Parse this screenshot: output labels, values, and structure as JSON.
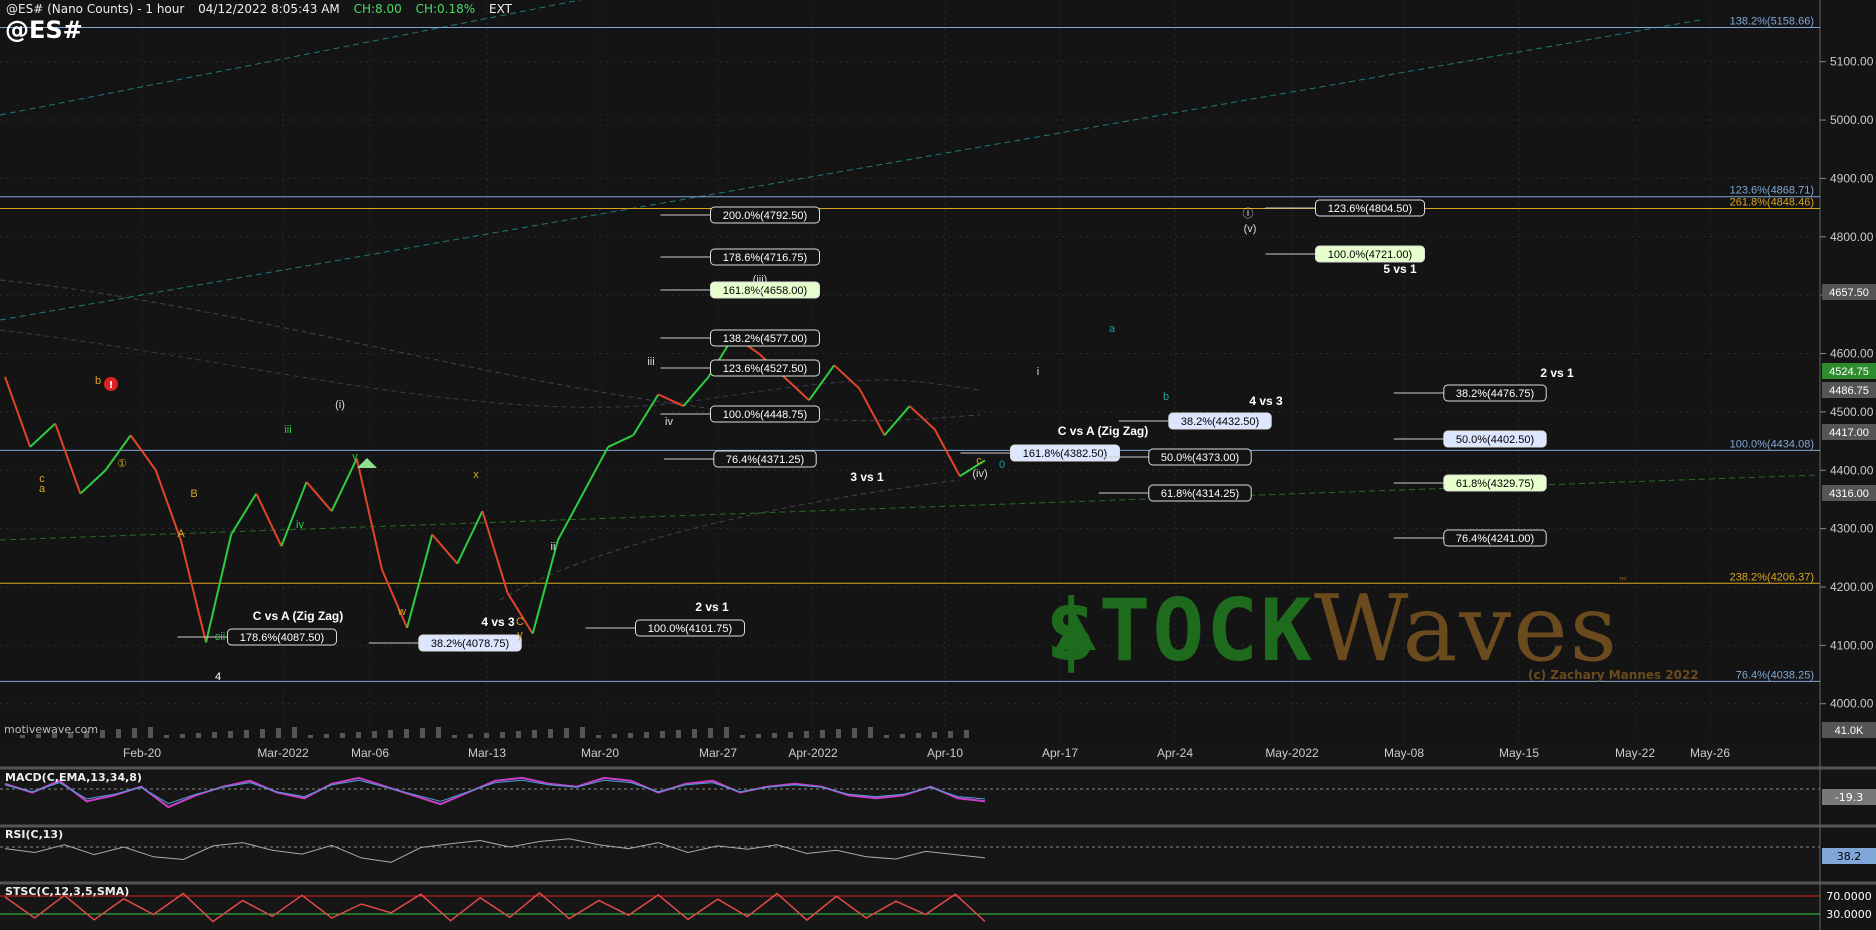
{
  "header": {
    "symbol_desc": "@ES# (Nano Counts) - 1 hour",
    "datetime": "04/12/2022 8:05:43 AM",
    "change": "CH:8.00",
    "change_pct": "CH:0.18%",
    "session": "EXT",
    "symbol": "@ES#",
    "source": "motivewave.com"
  },
  "watermark": {
    "brand1": "$TOCK",
    "brand2": "Waves",
    "tm": "™",
    "copyright": "(c) Zachary Mannes 2022"
  },
  "colors": {
    "bg": "#141414",
    "up": "#2ecc40",
    "down": "#e0452a",
    "grid": "#2a2a2a",
    "fib_gold": "#d9a520",
    "fib_blue": "#7fa8d8"
  },
  "chart_data": [
    {
      "type": "line",
      "title": "@ES# (Nano Counts) - 1 hour",
      "y_axis_ticks": [
        "5100.00",
        "5000.00",
        "4900.00",
        "4800.00",
        "4700.00",
        "4600.00",
        "4500.00",
        "4400.00",
        "4300.00",
        "4200.00",
        "4100.00",
        "4000.00"
      ],
      "x_axis_ticks": [
        "Feb-20",
        "Mar-2022",
        "Mar-06",
        "Mar-13",
        "Mar-20",
        "Mar-27",
        "Apr-2022",
        "Apr-10",
        "Apr-17",
        "Apr-24",
        "May-2022",
        "May-08",
        "May-15",
        "May-22",
        "May-26"
      ],
      "ylim": [
        3955,
        5180
      ],
      "price_path": [
        {
          "x": "Feb-14",
          "y": 4560
        },
        {
          "x": "Feb-15",
          "y": 4440
        },
        {
          "x": "Feb-16",
          "y": 4480
        },
        {
          "x": "Feb-17",
          "y": 4360
        },
        {
          "x": "Feb-18",
          "y": 4400
        },
        {
          "x": "Feb-19",
          "y": 4460
        },
        {
          "x": "Feb-20",
          "y": 4400
        },
        {
          "x": "Feb-22",
          "y": 4280
        },
        {
          "x": "Feb-24",
          "y": 4105
        },
        {
          "x": "Feb-25",
          "y": 4290
        },
        {
          "x": "Feb-28",
          "y": 4360
        },
        {
          "x": "Mar-01",
          "y": 4270
        },
        {
          "x": "Mar-02",
          "y": 4380
        },
        {
          "x": "Mar-04",
          "y": 4330
        },
        {
          "x": "Mar-05",
          "y": 4420
        },
        {
          "x": "Mar-06",
          "y": 4230
        },
        {
          "x": "Mar-08",
          "y": 4130
        },
        {
          "x": "Mar-09",
          "y": 4290
        },
        {
          "x": "Mar-10",
          "y": 4240
        },
        {
          "x": "Mar-11",
          "y": 4330
        },
        {
          "x": "Mar-12",
          "y": 4190
        },
        {
          "x": "Mar-14",
          "y": 4120
        },
        {
          "x": "Mar-15",
          "y": 4280
        },
        {
          "x": "Mar-16",
          "y": 4360
        },
        {
          "x": "Mar-18",
          "y": 4440
        },
        {
          "x": "Mar-20",
          "y": 4460
        },
        {
          "x": "Mar-22",
          "y": 4530
        },
        {
          "x": "Mar-24",
          "y": 4510
        },
        {
          "x": "Mar-27",
          "y": 4560
        },
        {
          "x": "Mar-29",
          "y": 4630
        },
        {
          "x": "Mar-31",
          "y": 4600
        },
        {
          "x": "Apr-01",
          "y": 4560
        },
        {
          "x": "Apr-02",
          "y": 4520
        },
        {
          "x": "Apr-04",
          "y": 4580
        },
        {
          "x": "Apr-05",
          "y": 4540
        },
        {
          "x": "Apr-06",
          "y": 4460
        },
        {
          "x": "Apr-08",
          "y": 4510
        },
        {
          "x": "Apr-10",
          "y": 4470
        },
        {
          "x": "Apr-11",
          "y": 4390
        },
        {
          "x": "Apr-12",
          "y": 4417
        }
      ],
      "price_badges": [
        {
          "label": "4657.50",
          "color": "#555555"
        },
        {
          "label": "4524.75",
          "color": "#2e8b2e"
        },
        {
          "label": "4486.75",
          "color": "#555555"
        },
        {
          "label": "4417.00",
          "color": "#555555"
        },
        {
          "label": "4316.00",
          "color": "#555555"
        },
        {
          "label": "41.0K",
          "color": "#555555"
        }
      ],
      "fib_lines": [
        {
          "label": "138.2%(5158.66)",
          "value": 5158.66,
          "color": "#7fa8d8"
        },
        {
          "label": "123.6%(4868.71)",
          "value": 4868.71,
          "color": "#7fa8d8"
        },
        {
          "label": "261.8%(4848.46)",
          "value": 4848.46,
          "color": "#d9a520"
        },
        {
          "label": "100.0%(4434.08)",
          "value": 4434.08,
          "color": "#7fa8d8"
        },
        {
          "label": "238.2%(4206.37)",
          "value": 4206.37,
          "color": "#d9a520"
        },
        {
          "label": "76.4%(4038.25)",
          "value": 4038.25,
          "color": "#7fa8d8"
        }
      ],
      "fib_boxes": [
        {
          "label": "200.0%(4792.50)"
        },
        {
          "label": "178.6%(4716.75)"
        },
        {
          "label": "161.8%(4658.00)",
          "highlight": "#e6ffcc"
        },
        {
          "label": "138.2%(4577.00)"
        },
        {
          "label": "123.6%(4527.50)"
        },
        {
          "label": "100.0%(4448.75)"
        },
        {
          "label": "76.4%(4371.25)"
        },
        {
          "label": "178.6%(4087.50)"
        },
        {
          "label": "38.2%(4078.75)",
          "highlight": "#dde6ff"
        },
        {
          "label": "100.0%(4101.75)"
        },
        {
          "label": "161.8%(4382.50)",
          "highlight": "#dde6ff"
        },
        {
          "label": "50.0%(4373.00)"
        },
        {
          "label": "61.8%(4314.25)"
        },
        {
          "label": "38.2%(4432.50)",
          "highlight": "#dde6ff"
        },
        {
          "label": "123.6%(4804.50)"
        },
        {
          "label": "100.0%(4721.00)",
          "highlight": "#e6ffcc"
        },
        {
          "label": "38.2%(4476.75)"
        },
        {
          "label": "50.0%(4402.50)",
          "highlight": "#dde6ff"
        },
        {
          "label": "61.8%(4329.75)",
          "highlight": "#e6ffcc"
        },
        {
          "label": "76.4%(4241.00)"
        }
      ],
      "annotations": [
        "3 vs 1",
        "C vs A (Zig Zag)",
        "4 vs 3",
        "2 vs 1",
        "C vs A (Zig Zag)",
        "4 vs 3",
        "5 vs 1",
        "2 vs 1"
      ],
      "wave_labels": [
        "a",
        "b",
        "c",
        "(i)",
        "iii",
        "iv",
        "v",
        "w",
        "x",
        "y",
        "(iii)",
        "(iv)",
        "(v)",
        "i",
        "ii",
        "iii",
        "iv",
        "v",
        "a",
        "b",
        "c",
        "0",
        "①",
        "Ⓘ",
        "4",
        "A",
        "B",
        "C",
        "cii"
      ]
    },
    {
      "type": "line",
      "title": "MACD(C,EMA,13,34,8)",
      "y_axis_ticks": [
        "-19.3"
      ],
      "series": [
        {
          "values": [
            0.2,
            -0.1,
            0.3,
            -0.4,
            -0.2,
            0.1,
            -0.6,
            -0.2,
            0.1,
            0.3,
            -0.1,
            -0.3,
            0.2,
            0.4,
            0.1,
            -0.2,
            -0.5,
            -0.1,
            0.3,
            0.4,
            0.2,
            0.1,
            0.4,
            0.3,
            -0.1,
            0.2,
            0.3,
            -0.1,
            0.1,
            0.2,
            0.1,
            -0.2,
            -0.3,
            -0.2,
            0.1,
            -0.3,
            -0.4
          ]
        }
      ]
    },
    {
      "type": "line",
      "title": "RSI(C,13)",
      "y_axis_ticks": [
        "38.2"
      ],
      "series": [
        {
          "values": [
            55,
            48,
            62,
            44,
            58,
            40,
            35,
            60,
            66,
            52,
            45,
            61,
            38,
            30,
            57,
            64,
            70,
            58,
            68,
            73,
            62,
            55,
            66,
            48,
            60,
            54,
            62,
            46,
            52,
            40,
            36,
            50,
            44,
            38
          ]
        }
      ]
    },
    {
      "type": "line",
      "title": "STSC(C,12,3,5,SMA)",
      "y_axis_ticks": [
        "70.0000",
        "30.0000"
      ],
      "series": [
        {
          "values": [
            80,
            20,
            85,
            15,
            75,
            30,
            90,
            10,
            70,
            25,
            85,
            20,
            60,
            35,
            88,
            12,
            78,
            22,
            92,
            18,
            70,
            28,
            86,
            16,
            74,
            24,
            90,
            14,
            82,
            20,
            68,
            30,
            88,
            10
          ]
        }
      ]
    }
  ]
}
